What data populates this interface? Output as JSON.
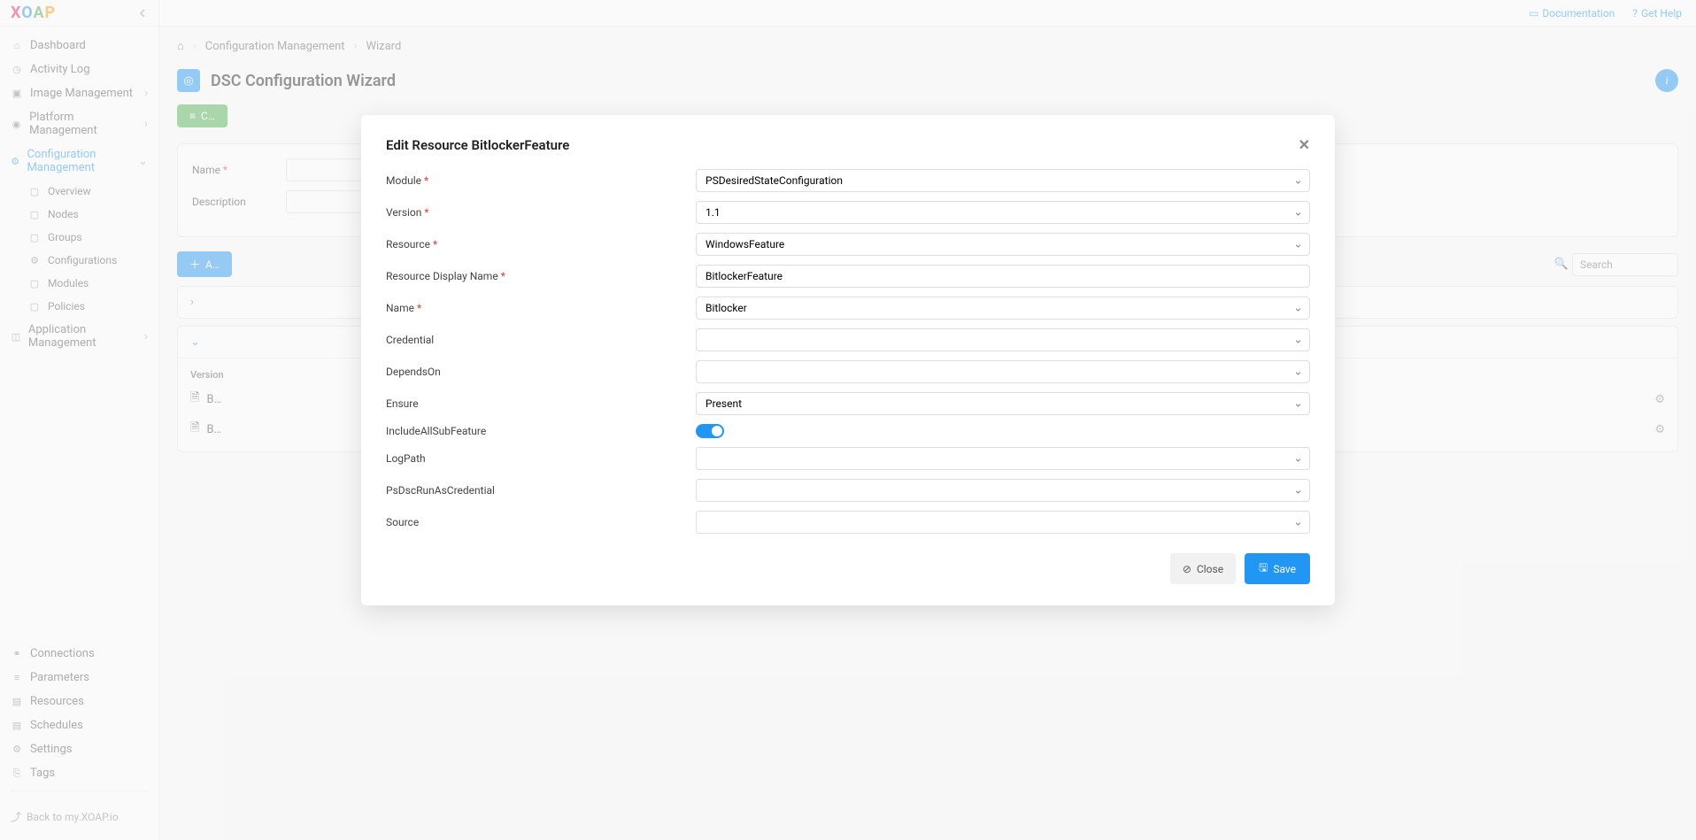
{
  "brand": {
    "x": "X",
    "o": "O",
    "a": "A",
    "p": "P"
  },
  "topbar": {
    "doc": "Documentation",
    "help": "Get Help"
  },
  "sidebar": {
    "items": [
      {
        "label": "Dashboard"
      },
      {
        "label": "Activity Log"
      },
      {
        "label": "Image Management"
      },
      {
        "label": "Platform Management"
      },
      {
        "label": "Configuration Management"
      }
    ],
    "config_sub": [
      {
        "label": "Overview"
      },
      {
        "label": "Nodes"
      },
      {
        "label": "Groups"
      },
      {
        "label": "Configurations"
      },
      {
        "label": "Modules"
      },
      {
        "label": "Policies"
      }
    ],
    "app_mgmt": "Application Management",
    "bottom": [
      {
        "label": "Connections"
      },
      {
        "label": "Parameters"
      },
      {
        "label": "Resources"
      },
      {
        "label": "Schedules"
      },
      {
        "label": "Settings"
      },
      {
        "label": "Tags"
      }
    ],
    "back": "Back to my.XOAP.io"
  },
  "breadcrumb": {
    "a": "Configuration Management",
    "b": "Wizard"
  },
  "page": {
    "title": "DSC Configuration Wizard",
    "btn": "C…",
    "add": "A…",
    "search_ph": "Search"
  },
  "form": {
    "name_label": "Name",
    "desc_label": "Description",
    "name_value": "",
    "desc_value": ""
  },
  "accordion": {
    "ver": "Version",
    "r1": "B…",
    "r2": "B…"
  },
  "modal": {
    "title": "Edit Resource BitlockerFeature",
    "fields": {
      "module_label": "Module",
      "module_val": "PSDesiredStateConfiguration",
      "version_label": "Version",
      "version_val": "1.1",
      "resource_label": "Resource",
      "resource_val": "WindowsFeature",
      "display_label": "Resource Display Name",
      "display_val": "BitlockerFeature",
      "name_label": "Name",
      "name_val": "Bitlocker",
      "cred_label": "Credential",
      "cred_val": "",
      "depends_label": "DependsOn",
      "depends_val": "",
      "ensure_label": "Ensure",
      "ensure_val": "Present",
      "include_label": "IncludeAllSubFeature",
      "log_label": "LogPath",
      "log_val": "",
      "runas_label": "PsDscRunAsCredential",
      "runas_val": "",
      "source_label": "Source",
      "source_val": ""
    },
    "close": "Close",
    "save": "Save"
  }
}
